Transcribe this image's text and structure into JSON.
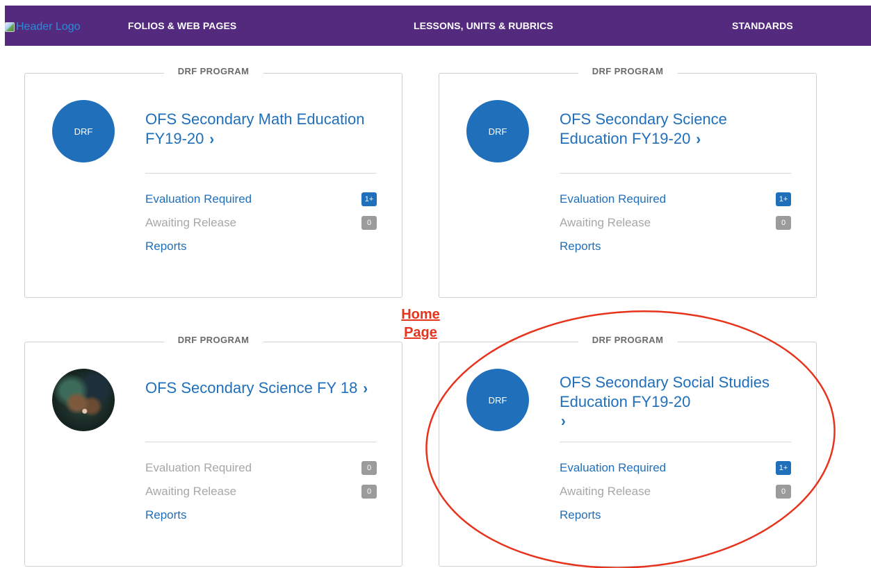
{
  "header": {
    "logo_alt": "Header Logo",
    "nav": [
      {
        "label": "FOLIOS & WEB PAGES"
      },
      {
        "label": "LESSONS, UNITS & RUBRICS"
      },
      {
        "label": "STANDARDS"
      }
    ]
  },
  "cards": [
    {
      "section_label": "DRF PROGRAM",
      "avatar_text": "DRF",
      "title": "OFS Secondary Math Education FY19-20",
      "chevron": "›",
      "rows": [
        {
          "label": "Evaluation Required",
          "badge": "1+"
        },
        {
          "label": "Awaiting Release",
          "badge": "0"
        },
        {
          "label": "Reports"
        }
      ]
    },
    {
      "section_label": "DRF PROGRAM",
      "avatar_text": "DRF",
      "title": "OFS Secondary Science Education FY19-20",
      "chevron": "›",
      "rows": [
        {
          "label": "Evaluation Required",
          "badge": "1+"
        },
        {
          "label": "Awaiting Release",
          "badge": "0"
        },
        {
          "label": "Reports"
        }
      ]
    },
    {
      "section_label": "DRF PROGRAM",
      "avatar_text": "",
      "title": "OFS Secondary Science FY 18",
      "chevron": "›",
      "rows": [
        {
          "label": "Evaluation Required",
          "badge": "0"
        },
        {
          "label": "Awaiting Release",
          "badge": "0"
        },
        {
          "label": "Reports"
        }
      ]
    },
    {
      "section_label": "DRF PROGRAM",
      "avatar_text": "DRF",
      "title": "OFS Secondary Social Studies Education FY19-20",
      "chevron": "›",
      "rows": [
        {
          "label": "Evaluation Required",
          "badge": "1+"
        },
        {
          "label": "Awaiting Release",
          "badge": "0"
        },
        {
          "label": "Reports"
        }
      ]
    }
  ],
  "annotation": {
    "line1": "Home",
    "line2": "Page",
    "color": "#e8331c"
  },
  "colors": {
    "header_bg": "#532a7e",
    "link_blue": "#1f6fbb",
    "badge_gray": "#9b9b9b",
    "muted_text": "#a7a7a7"
  }
}
